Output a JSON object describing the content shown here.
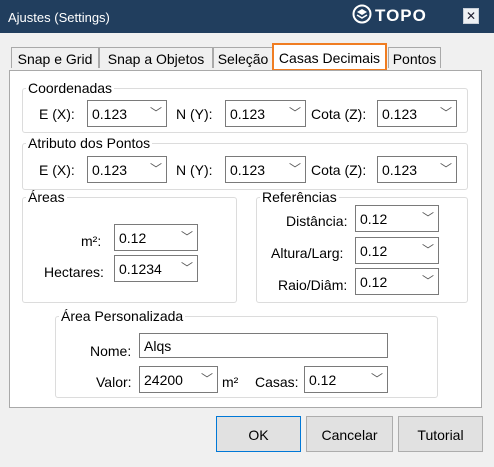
{
  "window": {
    "title": "Ajustes  (Settings)",
    "logo_text": "TOPO",
    "close_glyph": "✕"
  },
  "tabs": [
    {
      "label": "Snap e Grid",
      "active": false
    },
    {
      "label": "Snap a Objetos",
      "active": false
    },
    {
      "label": "Seleção",
      "active": false
    },
    {
      "label": "Casas Decimais",
      "active": true
    },
    {
      "label": "Pontos",
      "active": false
    }
  ],
  "coordenadas": {
    "title": "Coordenadas",
    "e_label": "E (X):",
    "e_value": "0.123",
    "n_label": "N (Y):",
    "n_value": "0.123",
    "cota_label": "Cota (Z):",
    "cota_value": "0.123"
  },
  "atributo": {
    "title": "Atributo dos Pontos",
    "e_label": "E (X):",
    "e_value": "0.123",
    "n_label": "N (Y):",
    "n_value": "0.123",
    "cota_label": "Cota (Z):",
    "cota_value": "0.123"
  },
  "areas": {
    "title": "Áreas",
    "m2_label": "m²:",
    "m2_value": "0.12",
    "hectares_label": "Hectares:",
    "hectares_value": "0.1234"
  },
  "referencias": {
    "title": "Referências",
    "distancia_label": "Distância:",
    "distancia_value": "0.12",
    "altura_label": "Altura/Larg:",
    "altura_value": "0.12",
    "raio_label": "Raio/Diâm:",
    "raio_value": "0.12"
  },
  "area_personalizada": {
    "title": "Área Personalizada",
    "nome_label": "Nome:",
    "nome_value": "Alqs",
    "valor_label": "Valor:",
    "valor_value": "24200",
    "unit": "m²",
    "casas_label": "Casas:",
    "casas_value": "0.12"
  },
  "buttons": {
    "ok": "OK",
    "cancel": "Cancelar",
    "tutorial": "Tutorial"
  },
  "colors": {
    "titlebar": "#213e5e",
    "active_tab_border": "#f07d22"
  },
  "icons": {
    "dropdown": "chevron-down-icon",
    "logo": "topo-logo-icon",
    "close": "close-icon"
  }
}
